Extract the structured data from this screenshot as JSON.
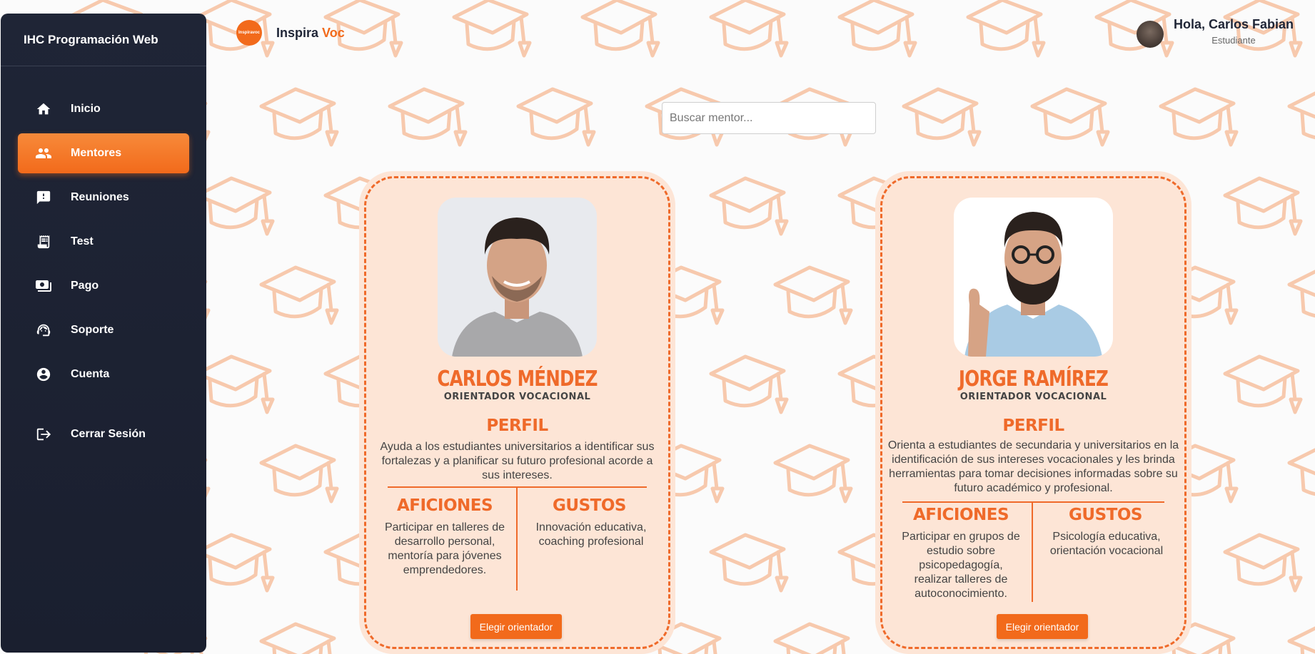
{
  "app": {
    "brand": "IHC Programación Web",
    "logo_name": "Inspira",
    "logo_accent": "Voc",
    "logo_badge": "Inspiravoc"
  },
  "sidebar": {
    "items": [
      {
        "label": "Inicio",
        "icon": "home-icon",
        "active": false
      },
      {
        "label": "Mentores",
        "icon": "people-icon",
        "active": true
      },
      {
        "label": "Reuniones",
        "icon": "chat-alert-icon",
        "active": false
      },
      {
        "label": "Test",
        "icon": "receipt-icon",
        "active": false
      },
      {
        "label": "Pago",
        "icon": "payment-icon",
        "active": false
      },
      {
        "label": "Soporte",
        "icon": "support-icon",
        "active": false
      },
      {
        "label": "Cuenta",
        "icon": "account-icon",
        "active": false
      }
    ],
    "logout": {
      "label": "Cerrar Sesión",
      "icon": "logout-icon"
    }
  },
  "user": {
    "greeting": "Hola, Carlos Fabian",
    "role": "Estudiante"
  },
  "search": {
    "placeholder": "Buscar mentor...",
    "value": ""
  },
  "mentors": [
    {
      "name": "CARLOS MÉNDEZ",
      "role": "ORIENTADOR VOCACIONAL",
      "perfil_title": "PERFIL",
      "perfil": "Ayuda a los estudiantes universitarios a identificar sus  fortalezas y a planificar su futuro profesional acorde a sus intereses.",
      "aficiones_title": "AFICIONES",
      "aficiones": "Participar en talleres de desarrollo personal, mentoría para jóvenes emprendedores.",
      "gustos_title": "GUSTOS",
      "gustos": "Innovación educativa, coaching profesional",
      "button": "Elegir orientador"
    },
    {
      "name": "JORGE RAMÍREZ",
      "role": "ORIENTADOR VOCACIONAL",
      "perfil_title": "PERFIL",
      "perfil": "Orienta a estudiantes de secundaria y universitarios en la identificación de sus intereses vocacionales y les brinda herramientas para tomar decisiones informadas sobre su futuro académico y profesional.",
      "aficiones_title": "AFICIONES",
      "aficiones": "Participar en grupos de estudio sobre psicopedagogía, realizar talleres de autoconocimiento.",
      "gustos_title": "GUSTOS",
      "gustos": "Psicología educativa, orientación vocacional",
      "button": "Elegir orientador"
    }
  ],
  "colors": {
    "accent": "#f26a1b",
    "sidebar_bg": "#1f2536",
    "card_bg": "#fde5d6",
    "pattern": "#f7c9ad"
  }
}
